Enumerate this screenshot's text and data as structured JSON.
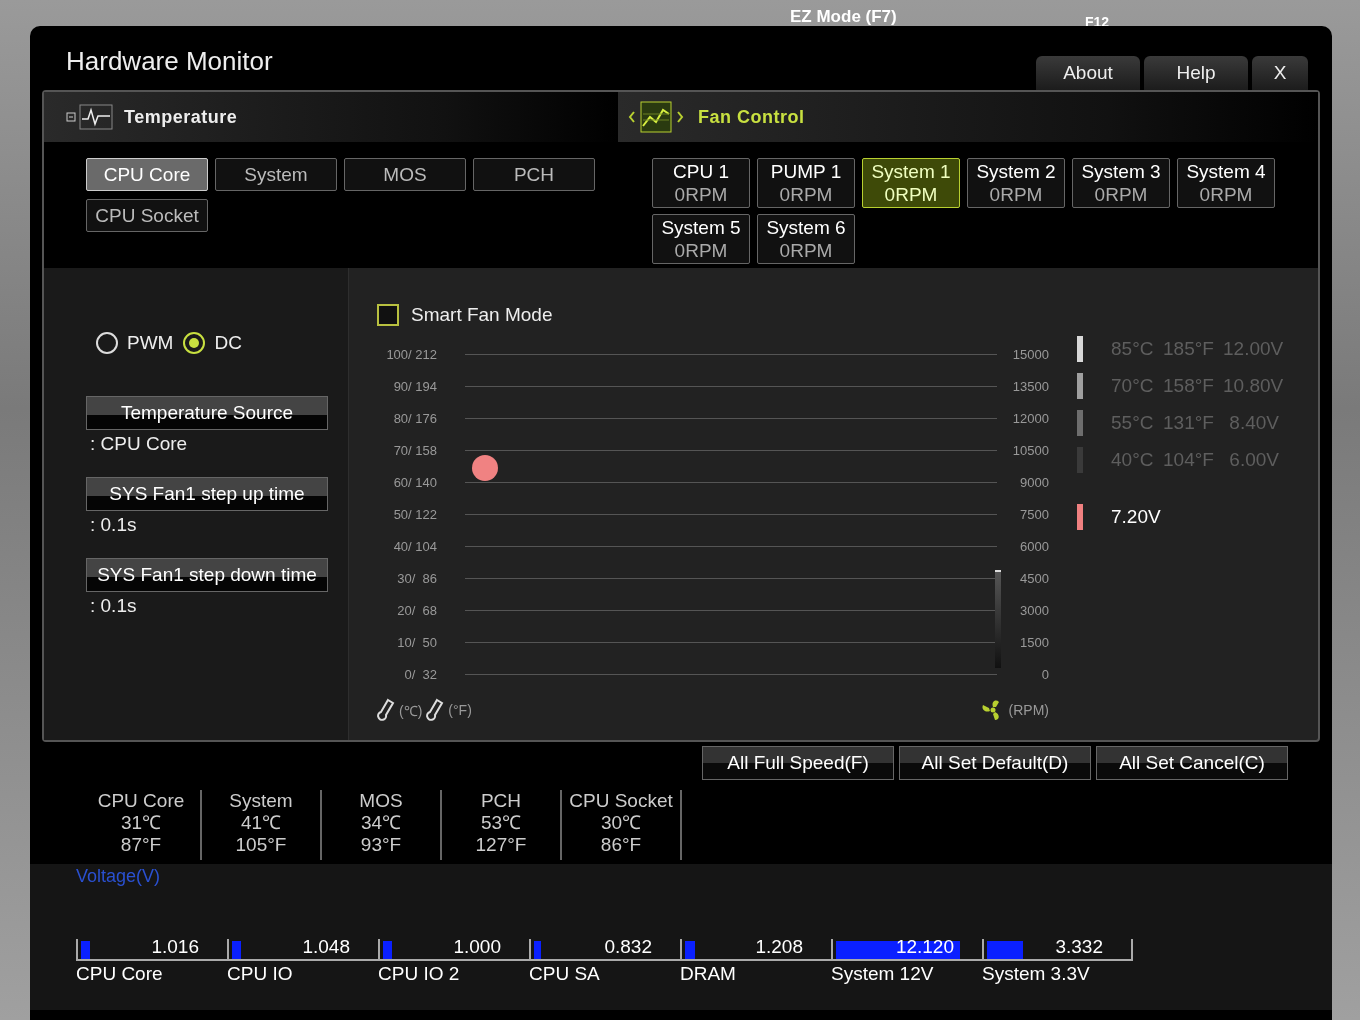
{
  "background": {
    "texts": [
      "EZ Mode (F7)",
      "F12"
    ]
  },
  "window": {
    "title": "Hardware Monitor",
    "buttons": [
      {
        "label": "About"
      },
      {
        "label": "Help"
      },
      {
        "label": "X"
      }
    ]
  },
  "temperature_panel": {
    "title": "Temperature",
    "sources": [
      {
        "label": "CPU Core",
        "selected": true
      },
      {
        "label": "System",
        "selected": false
      },
      {
        "label": "MOS",
        "selected": false
      },
      {
        "label": "PCH",
        "selected": false
      },
      {
        "label": "CPU Socket",
        "selected": false
      }
    ]
  },
  "fan_panel": {
    "title": "Fan Control",
    "fans": [
      {
        "name": "CPU 1",
        "rpm": "0RPM",
        "selected": false
      },
      {
        "name": "PUMP 1",
        "rpm": "0RPM",
        "selected": false
      },
      {
        "name": "System 1",
        "rpm": "0RPM",
        "selected": true
      },
      {
        "name": "System 2",
        "rpm": "0RPM",
        "selected": false
      },
      {
        "name": "System 3",
        "rpm": "0RPM",
        "selected": false
      },
      {
        "name": "System 4",
        "rpm": "0RPM",
        "selected": false
      },
      {
        "name": "System 5",
        "rpm": "0RPM",
        "selected": false
      },
      {
        "name": "System 6",
        "rpm": "0RPM",
        "selected": false
      }
    ]
  },
  "fan_settings": {
    "modes": [
      {
        "label": "PWM",
        "selected": false
      },
      {
        "label": "DC",
        "selected": true
      }
    ],
    "fields": [
      {
        "label": "Temperature Source",
        "value": ": CPU Core"
      },
      {
        "label": "SYS Fan1 step up time",
        "value": ": 0.1s"
      },
      {
        "label": "SYS Fan1 step down time",
        "value": ": 0.1s"
      }
    ]
  },
  "graph": {
    "smart_fan_mode": {
      "label": "Smart Fan Mode",
      "checked": false
    },
    "left_ticks": [
      "100/ 212",
      "90/ 194",
      "80/ 176",
      "70/ 158",
      "60/ 140",
      "50/ 122",
      "40/ 104",
      "30/  86",
      "20/  68",
      "10/  50",
      "0/  32"
    ],
    "right_ticks": [
      "15000",
      "13500",
      "12000",
      "10500",
      "9000",
      "7500",
      "6000",
      "4500",
      "3000",
      "1500",
      "0"
    ],
    "celsius_unit": "(℃)",
    "fahrenheit_unit": "(°F)",
    "rpm_unit": "(RPM)"
  },
  "legend": {
    "rows": [
      {
        "celsius": "85°C",
        "fahrenheit": "185°F",
        "voltage": "12.00V",
        "color": "#d8d8d8"
      },
      {
        "celsius": "70°C",
        "fahrenheit": "158°F",
        "voltage": "10.80V",
        "color": "#a0a0a0"
      },
      {
        "celsius": "55°C",
        "fahrenheit": "131°F",
        "voltage": "8.40V",
        "color": "#6e6e6e"
      },
      {
        "celsius": "40°C",
        "fahrenheit": "104°F",
        "voltage": "6.00V",
        "color": "#3a3a3a"
      }
    ],
    "current": {
      "voltage": "7.20V",
      "color": "#f08080"
    }
  },
  "actions": [
    {
      "label": "All Full Speed(F)"
    },
    {
      "label": "All Set Default(D)"
    },
    {
      "label": "All Set Cancel(C)"
    }
  ],
  "readings": [
    {
      "name": "CPU Core",
      "celsius": "31℃",
      "fahrenheit": "87°F"
    },
    {
      "name": "System",
      "celsius": "41℃",
      "fahrenheit": "105°F"
    },
    {
      "name": "MOS",
      "celsius": "34℃",
      "fahrenheit": "93°F"
    },
    {
      "name": "PCH",
      "celsius": "53℃",
      "fahrenheit": "127°F"
    },
    {
      "name": "CPU Socket",
      "celsius": "30℃",
      "fahrenheit": "86°F"
    }
  ],
  "voltage": {
    "title": "Voltage(V)",
    "items": [
      {
        "name": "CPU Core",
        "value": "1.016",
        "level": 0.06
      },
      {
        "name": "CPU IO",
        "value": "1.048",
        "level": 0.06
      },
      {
        "name": "CPU IO 2",
        "value": "1.000",
        "level": 0.06
      },
      {
        "name": "CPU SA",
        "value": "0.832",
        "level": 0.05
      },
      {
        "name": "DRAM",
        "value": "1.208",
        "level": 0.07
      },
      {
        "name": "System 12V",
        "value": "12.120",
        "level": 0.85
      },
      {
        "name": "System 3.3V",
        "value": "3.332",
        "level": 0.25
      }
    ]
  }
}
